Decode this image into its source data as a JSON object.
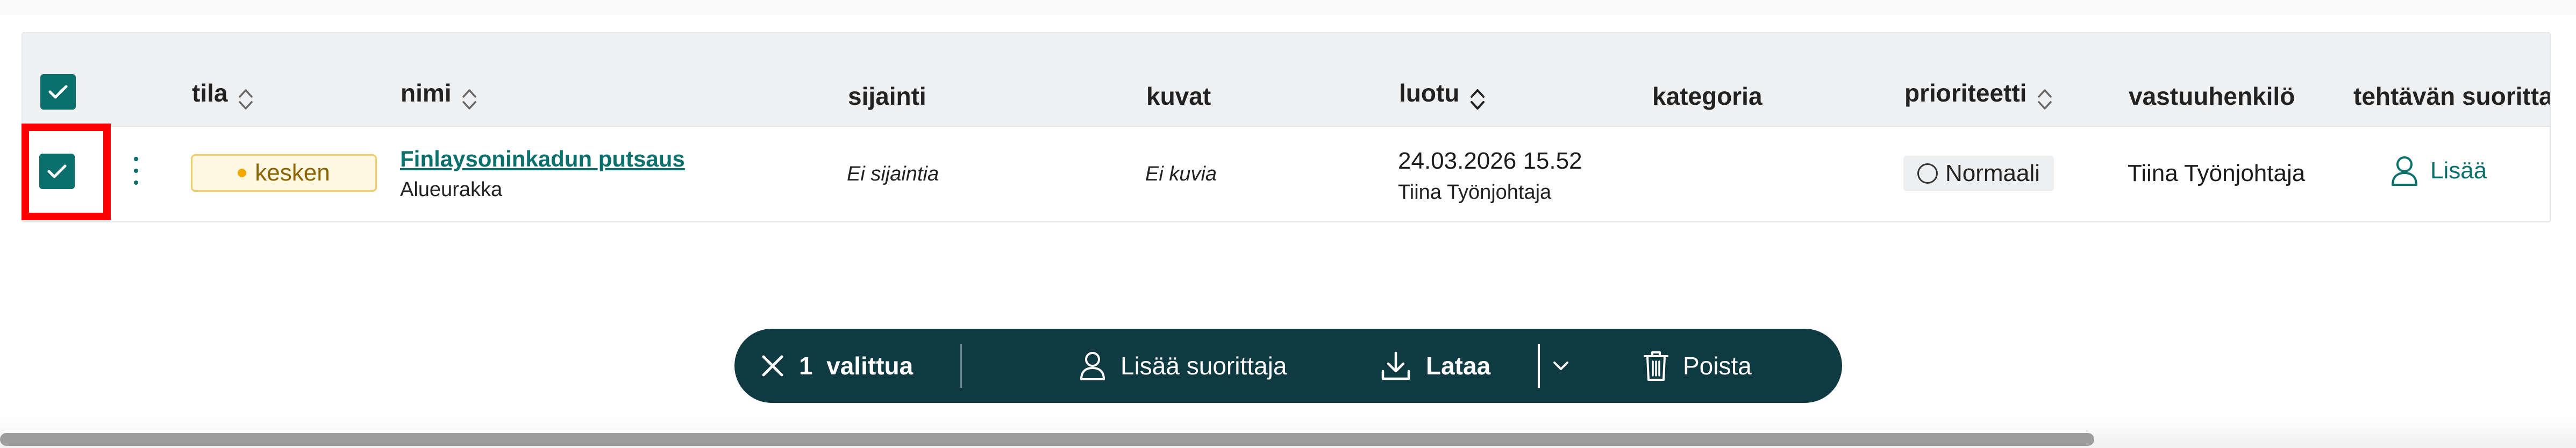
{
  "table": {
    "columns": [
      {
        "key": "tila",
        "label": "tila"
      },
      {
        "key": "nimi",
        "label": "nimi"
      },
      {
        "key": "sijainti",
        "label": "sijainti"
      },
      {
        "key": "kuvat",
        "label": "kuvat"
      },
      {
        "key": "luotu",
        "label": "luotu"
      },
      {
        "key": "kategoria",
        "label": "kategoria"
      },
      {
        "key": "prioriteetti",
        "label": "prioriteetti"
      },
      {
        "key": "vastuuhenkilo",
        "label": "vastuuhenkilö"
      },
      {
        "key": "tehtavan_suorittaja",
        "label": "tehtävän suoritta"
      }
    ],
    "rows": [
      {
        "status": "kesken",
        "name": "Finlaysoninkadun putsaus",
        "contract": "Alueurakka",
        "location": "Ei sijaintia",
        "images": "Ei kuvia",
        "created_date": "24.03.2026 15.52",
        "created_by": "Tiina Työnjohtaja",
        "category": "",
        "priority": "Normaali",
        "responsible": "Tiina Työnjohtaja",
        "assignee_action": "Lisää"
      }
    ]
  },
  "action_bar": {
    "selected_count_label": "1  valittua",
    "add_assignee": "Lisää suorittaja",
    "download": "Lataa",
    "delete": "Poista"
  },
  "colors": {
    "accent": "#0b6f6c",
    "action_bar_bg": "#0f3a42",
    "highlight": "#ff0000",
    "status_badge_bg": "#fff8e1",
    "status_badge_border": "#f0cc6a",
    "status_dot": "#f3a800"
  },
  "icons": {
    "header_checkbox": "checkmark-icon",
    "row_checkbox": "checkmark-icon",
    "sort": "sort-updown-icon",
    "row_menu": "kebab-icon",
    "assignee": "user-icon",
    "clear": "close-icon",
    "download": "download-icon",
    "dropdown": "chevron-down-icon",
    "delete": "trash-icon"
  }
}
